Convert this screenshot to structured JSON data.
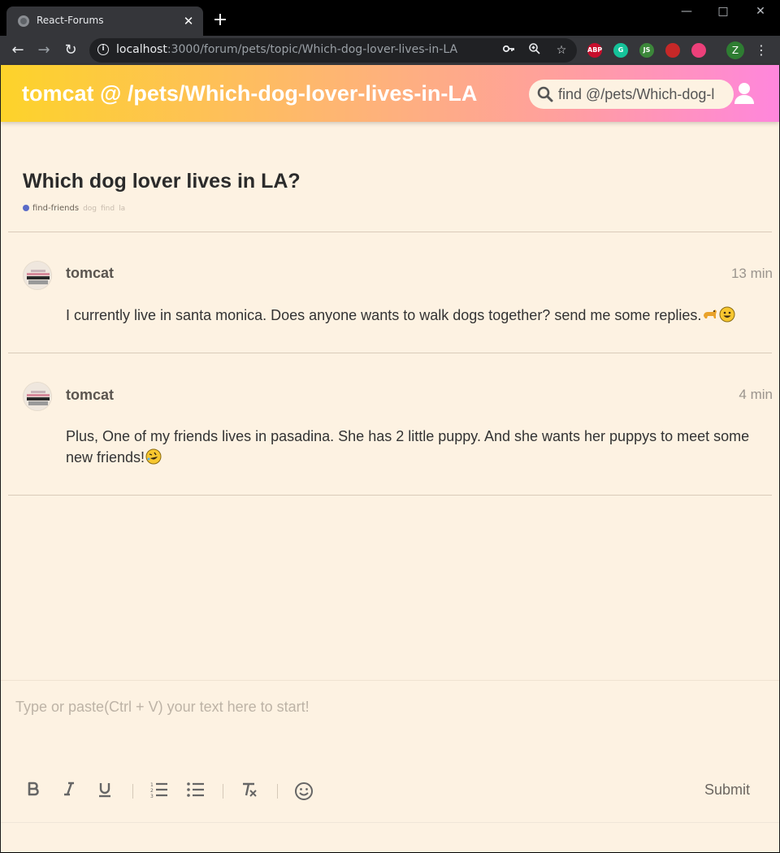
{
  "browser": {
    "tab_title": "React-Forums",
    "close_glyph": "✕",
    "newtab_glyph": "+",
    "url_host": "localhost",
    "url_path": ":3000/forum/pets/topic/Which-dog-lover-lives-in-LA",
    "extensions": [
      {
        "name": "adblock-plus",
        "label": "ABP",
        "color": "#c70d2c"
      },
      {
        "name": "grammarly",
        "label": "G",
        "color": "#15c39a"
      },
      {
        "name": "nodejs",
        "label": "JS",
        "color": "#3c873a"
      },
      {
        "name": "ext-red",
        "label": "",
        "color": "#c62828"
      },
      {
        "name": "dark-mode",
        "label": "",
        "color": "#ec407a"
      }
    ],
    "profile_initial": "Z"
  },
  "app": {
    "title": "tomcat @ /pets/Which-dog-lover-lives-in-LA",
    "search_placeholder": "find @/pets/Which-dog-l",
    "topic": {
      "title": "Which dog lover lives in LA?",
      "category": "find-friends",
      "category_color": "#5a6bc8",
      "tags": [
        "dog",
        "find",
        "la"
      ]
    },
    "posts": [
      {
        "author": "tomcat",
        "time": "13 min",
        "text": "I currently live in santa monica. Does anyone wants to walk dogs together? send me some replies.",
        "emojis": [
          "dog-emoji",
          "grinning-face-emoji"
        ]
      },
      {
        "author": "tomcat",
        "time": "4 min",
        "text": "Plus, One of my friends lives in pasadina. She has 2 little puppy. And she wants her puppys to meet some new friends!",
        "emojis": [
          "rofl-emoji"
        ]
      }
    ],
    "editor": {
      "placeholder": "Type or paste(Ctrl + V) your text here to start!",
      "submit_label": "Submit",
      "tools": [
        "bold",
        "italic",
        "underline",
        "ordered-list",
        "bullet-list",
        "clear-format",
        "emoji"
      ]
    },
    "colors": {
      "background": "#fdf2e2",
      "appbar_gradient": [
        "#fdd32a",
        "#feb27a",
        "#ff9f9e",
        "#ff86dc"
      ]
    }
  }
}
